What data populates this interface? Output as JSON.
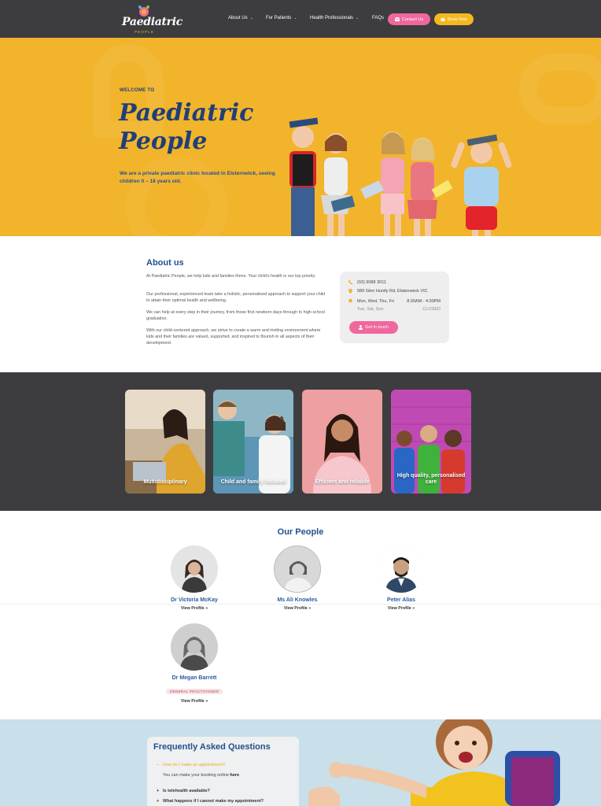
{
  "header": {
    "logo_text": "Paediatric",
    "logo_sub": "PEOPLE",
    "nav": [
      {
        "label": "About Us",
        "has_dropdown": true
      },
      {
        "label": "For Patients",
        "has_dropdown": true
      },
      {
        "label": "Health Professionals",
        "has_dropdown": true
      },
      {
        "label": "FAQs",
        "has_dropdown": false
      }
    ],
    "contact_label": "Contact Us",
    "book_label": "Book Now",
    "colors": {
      "bg": "#3d3d3f",
      "pink": "#f0679e",
      "yellow": "#f4b81e"
    }
  },
  "hero": {
    "welcome": "WELCOME TO",
    "title_line1": "Paediatric",
    "title_line2": "People",
    "subtitle": "We are a private paediatric clinic located in Elsternwick, seeing children 0 – 18 years old.",
    "bg_color": "#f2b42b"
  },
  "about": {
    "title": "About us",
    "paragraphs": [
      "At Paediatric People, we help kids and families thrive. Your child’s health is our top priority.",
      "Our professional, experienced team take a holistic, personalised approach to support your child to attain their optimal health and wellbeing.",
      "We can help at every step in their journey, from those first newborn days through to high school graduation.",
      "With our child-centered approach, we strive to create a warm and inviting environment where kids  and their families are valued, supported, and inspired to flourish in all aspects of their development."
    ],
    "contact": {
      "phone": "(03) 9088 3011",
      "address": "589 Glen Huntly Rd, Elsternwick VIC",
      "hours": [
        {
          "days": "Mon, Wed, Thu, Fri",
          "time": "8:30AM - 4:30PM"
        },
        {
          "days": "Tue, Sat, Sun",
          "time": "CLOSED"
        }
      ],
      "button_label": "Get in touch"
    }
  },
  "features": [
    {
      "label": "Multidisciplinary"
    },
    {
      "label": "Child and family focused"
    },
    {
      "label": "Efficient and reliable"
    },
    {
      "label": "High quality, personalised care"
    }
  ],
  "people": {
    "title": "Our People",
    "members": [
      {
        "name": "Dr Victoria McKay",
        "role": "",
        "link": "View Profile »"
      },
      {
        "name": "Ms Ali Knowles",
        "role": "",
        "link": "View Profile »"
      },
      {
        "name": "Peter Alias",
        "role": "",
        "link": "View Profile »"
      },
      {
        "name": "Dr Megan Barrett",
        "role": "GENERAL PRACTITIONER",
        "link": "View Profile »"
      }
    ]
  },
  "faq": {
    "title": "Frequently Asked Questions",
    "items": [
      {
        "question": "How do I make an appointment?",
        "open": true,
        "answer_prefix": "You can make your booking online ",
        "answer_link": "here"
      },
      {
        "question": "Is telehealth available?",
        "open": false
      },
      {
        "question": "What happens if I cannot make my appointment?",
        "open": false
      }
    ]
  }
}
